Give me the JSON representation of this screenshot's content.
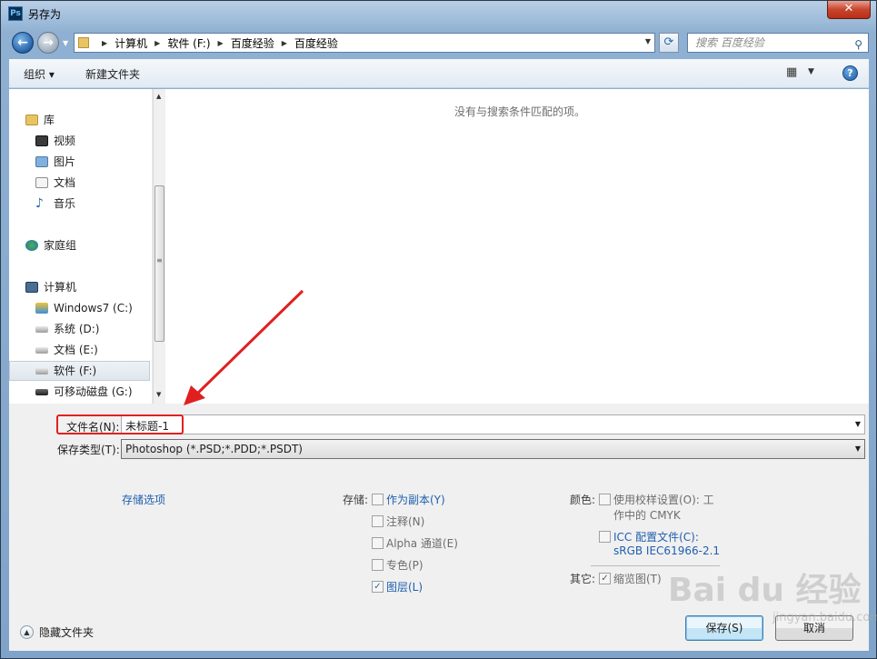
{
  "window": {
    "title": "另存为",
    "close": "✕"
  },
  "address": {
    "crumbs": [
      "计算机",
      "软件 (F:)",
      "百度经验",
      "百度经验"
    ],
    "search_placeholder": "搜索 百度经验"
  },
  "toolbar": {
    "organize": "组织 ▾",
    "new_folder": "新建文件夹"
  },
  "nav": {
    "items": [
      {
        "label": "库",
        "icon": "library-icon"
      },
      {
        "label": "视频",
        "icon": "video-icon"
      },
      {
        "label": "图片",
        "icon": "picture-icon"
      },
      {
        "label": "文档",
        "icon": "document-icon"
      },
      {
        "label": "音乐",
        "icon": "music-icon"
      },
      {
        "label": "家庭组",
        "icon": "homegroup-icon"
      },
      {
        "label": "计算机",
        "icon": "computer-icon"
      },
      {
        "label": "Windows7 (C:)",
        "icon": "system-drive-icon"
      },
      {
        "label": "系统 (D:)",
        "icon": "drive-icon"
      },
      {
        "label": "文档 (E:)",
        "icon": "drive-icon"
      },
      {
        "label": "软件 (F:)",
        "icon": "drive-icon"
      },
      {
        "label": "可移动磁盘 (G:)",
        "icon": "removable-drive-icon"
      }
    ],
    "selected": "软件 (F:)"
  },
  "main": {
    "empty_message": "没有与搜索条件匹配的项。"
  },
  "form": {
    "filename_label": "文件名(N):",
    "filename_value": "未标题-1",
    "filetype_label": "保存类型(T):",
    "filetype_value": "Photoshop (*.PSD;*.PDD;*.PSDT)"
  },
  "options": {
    "save_options_link": "存储选项",
    "storage_label": "存储:",
    "as_copy": "作为副本(Y)",
    "notes": "注释(N)",
    "alpha": "Alpha 通道(E)",
    "spot": "专色(P)",
    "layers": "图层(L)",
    "color_label": "颜色:",
    "use_proof_line1": "使用校样设置(O): 工",
    "use_proof_line2": "作中的 CMYK",
    "icc_line1": "ICC 配置文件(C):",
    "icc_line2": "sRGB IEC61966-2.1",
    "other_label": "其它:",
    "thumbnail": "缩览图(T)",
    "checks": {
      "as_copy": false,
      "notes": false,
      "alpha": false,
      "spot": false,
      "layers": true,
      "use_proof": false,
      "icc": false,
      "thumbnail": true
    }
  },
  "footer": {
    "hide_folders": "隐藏文件夹",
    "save": "保存(S)",
    "cancel": "取消"
  },
  "watermark": {
    "main": "Bai du 经验",
    "sub": "jingyan.baidu.com"
  },
  "colors": {
    "annotation": "#e02020",
    "link": "#1f5fae"
  }
}
